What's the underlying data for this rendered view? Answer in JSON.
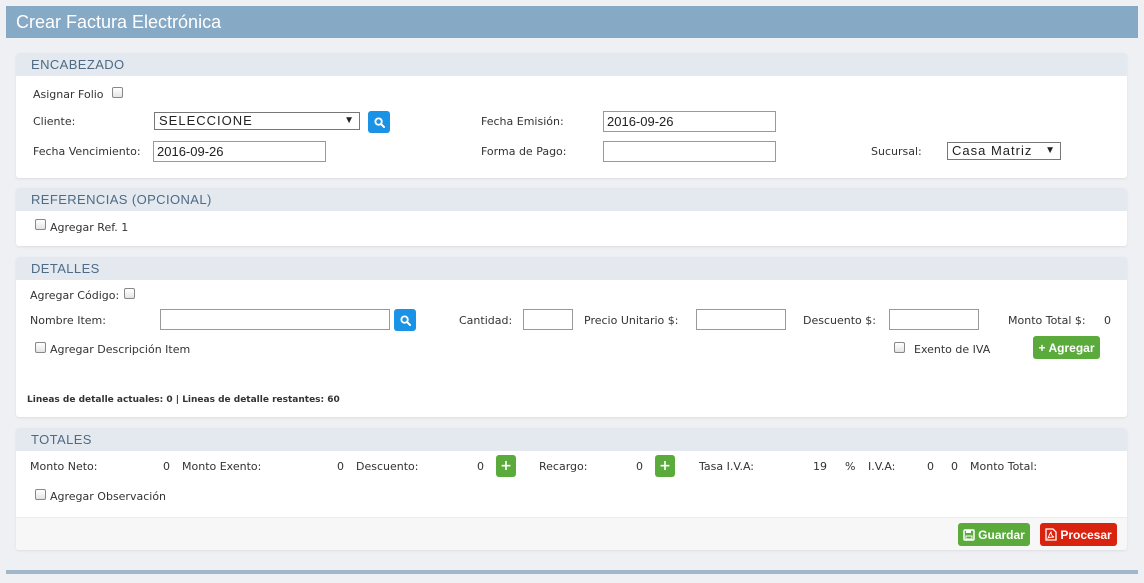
{
  "page": {
    "title": "Crear Factura Electrónica"
  },
  "encabezado": {
    "title": "ENCABEZADO",
    "asignar_folio_label": "Asignar Folio",
    "cliente_label": "Cliente:",
    "cliente_value": "SELECCIONE",
    "fecha_emision_label": "Fecha Emisión:",
    "fecha_emision_value": "2016-09-26",
    "fecha_vencimiento_label": "Fecha Vencimiento:",
    "fecha_vencimiento_value": "2016-09-26",
    "forma_pago_label": "Forma de Pago:",
    "forma_pago_value": "",
    "sucursal_label": "Sucursal:",
    "sucursal_value": "Casa Matriz"
  },
  "referencias": {
    "title": "REFERENCIAS (OPCIONAL)",
    "agregar_ref_label": "Agregar Ref. 1"
  },
  "detalles": {
    "title": "DETALLES",
    "agregar_codigo_label": "Agregar Código:",
    "nombre_item_label": "Nombre Item:",
    "nombre_item_value": "",
    "cantidad_label": "Cantidad:",
    "cantidad_value": "",
    "precio_unitario_label": "Precio Unitario $:",
    "precio_unitario_value": "",
    "descuento_label": "Descuento $:",
    "descuento_value": "",
    "monto_total_label": "Monto Total $:",
    "monto_total_value": "0",
    "agregar_descripcion_label": "Agregar Descripción Item",
    "exento_iva_label": "Exento de IVA",
    "agregar_button": "Agregar",
    "lineas_info": "Lineas de detalle actuales: 0 | Lineas de detalle restantes: 60"
  },
  "totales": {
    "title": "TOTALES",
    "monto_neto_label": "Monto Neto:",
    "monto_neto_value": "0",
    "monto_exento_label": "Monto Exento:",
    "monto_exento_value": "0",
    "descuento_label": "Descuento:",
    "descuento_value": "0",
    "recargo_label": "Recargo:",
    "recargo_value": "0",
    "tasa_iva_label": "Tasa I.V.A:",
    "tasa_iva_value": "19",
    "tasa_iva_unit": "%",
    "iva_label": "I.V.A:",
    "iva_value_1": "0",
    "iva_value_2": "0",
    "monto_total_label": "Monto Total:",
    "agregar_observacion_label": "Agregar Observación",
    "guardar_button": "Guardar",
    "procesar_button": "Procesar"
  },
  "icons": {
    "search": "search-icon",
    "plus": "plus-icon",
    "save": "save-icon",
    "pdf": "pdf-icon"
  },
  "colors": {
    "title_bar": "#86a9c6",
    "panel_header": "#e3e9ef",
    "search_button": "#1a93e6",
    "green_button": "#5aab3c",
    "red_button": "#d9230f"
  }
}
